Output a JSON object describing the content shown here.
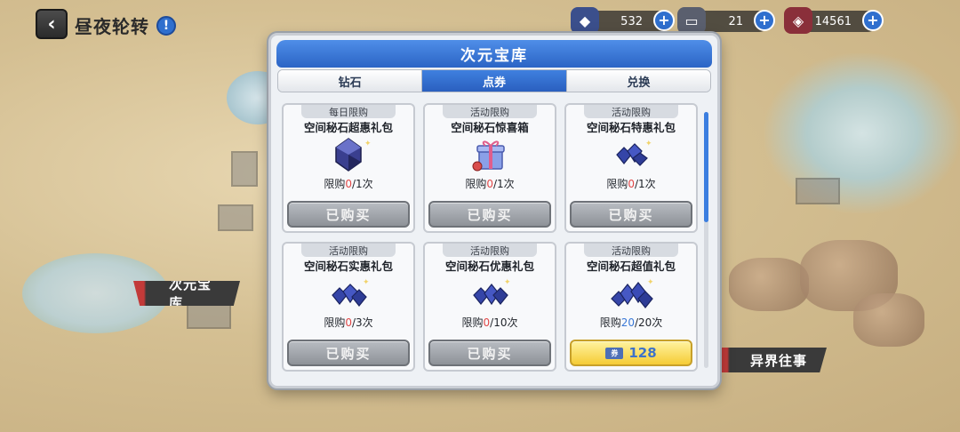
{
  "topbar": {
    "back_label": "‹",
    "title": "昼夜轮转",
    "info_label": "!"
  },
  "resources": [
    {
      "name": "resource-1",
      "value": "532",
      "icon": "crystal-icon",
      "plus": "+"
    },
    {
      "name": "resource-2",
      "value": "21",
      "icon": "ticket-icon",
      "plus": "+"
    },
    {
      "name": "resource-3",
      "value": "14561",
      "icon": "gem-icon",
      "plus": "+"
    }
  ],
  "map_labels": {
    "left": "次元宝库",
    "right": "异界往事"
  },
  "modal": {
    "title": "次元宝库",
    "tabs": [
      {
        "label": "钻石",
        "active": false
      },
      {
        "label": "点券",
        "active": true
      },
      {
        "label": "兑换",
        "active": false
      }
    ],
    "items": [
      {
        "tag": "每日限购",
        "name": "空间秘石超惠礼包",
        "icon": "dark-crystal-icon",
        "limit_prefix": "限购",
        "limit_current": "0",
        "limit_total": "/1次",
        "button": "已购买",
        "purchased": true
      },
      {
        "tag": "活动限购",
        "name": "空间秘石惊喜箱",
        "icon": "gift-box-icon",
        "limit_prefix": "限购",
        "limit_current": "0",
        "limit_total": "/1次",
        "button": "已购买",
        "purchased": true
      },
      {
        "tag": "活动限购",
        "name": "空间秘石特惠礼包",
        "icon": "crystal-cluster-icon",
        "limit_prefix": "限购",
        "limit_current": "0",
        "limit_total": "/1次",
        "button": "已购买",
        "purchased": true
      },
      {
        "tag": "活动限购",
        "name": "空间秘石实惠礼包",
        "icon": "crystal-cluster-icon",
        "limit_prefix": "限购",
        "limit_current": "0",
        "limit_total": "/3次",
        "button": "已购买",
        "purchased": true
      },
      {
        "tag": "活动限购",
        "name": "空间秘石优惠礼包",
        "icon": "crystal-cluster-icon",
        "limit_prefix": "限购",
        "limit_current": "0",
        "limit_total": "/10次",
        "button": "已购买",
        "purchased": true
      },
      {
        "tag": "活动限购",
        "name": "空间秘石超值礼包",
        "icon": "crystal-pile-icon",
        "limit_prefix": "限购",
        "limit_current": "20",
        "limit_total": "/20次",
        "button": "128",
        "purchased": false
      }
    ],
    "scroll_position": 0.0
  },
  "colors": {
    "accent_blue": "#2b64c5",
    "limit_red": "#e04848",
    "buy_yellow": "#f5cc36"
  }
}
